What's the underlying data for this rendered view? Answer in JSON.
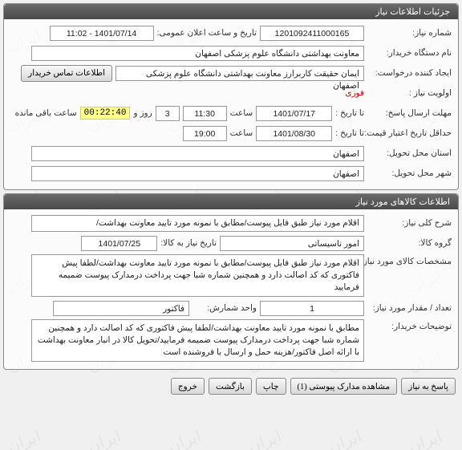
{
  "panel1": {
    "title": "جزئیات اطلاعات نیاز",
    "need_number_label": "شماره نیاز:",
    "need_number": "1201092411000165",
    "public_announce_label": "تاریخ و ساعت اعلان عمومی:",
    "public_announce": "1401/07/14 - 11:02",
    "buyer_org_label": "نام دستگاه خریدار:",
    "buyer_org": "معاونت بهداشتی دانشگاه علوم پزشکی اصفهان",
    "requester_label": "ایجاد کننده درخواست:",
    "requester": "ایمان حقیقت کاربرارز معاونت بهداشتی دانشگاه علوم پزشکی اصفهان",
    "contact_btn": "اطلاعات تماس خریدار",
    "priority_label": "اولویت نیاز :",
    "priority": "فوری",
    "deadline_reply_label": "مهلت ارسال پاسخ:",
    "to_date_label": "تا تاریخ :",
    "deadline_date": "1401/07/17",
    "time_label": "ساعت",
    "deadline_time": "11:30",
    "days_count": "3",
    "days_and": "روز و",
    "timer": "00:22:40",
    "remaining_label": "ساعت باقی مانده",
    "min_validity_label": "حداقل تاریخ اعتبار قیمت:",
    "validity_date": "1401/08/30",
    "validity_time": "19:00",
    "delivery_province_label": "استان محل تحویل:",
    "delivery_province": "اصفهان",
    "delivery_city_label": "شهر محل تحویل:",
    "delivery_city": "اصفهان"
  },
  "panel2": {
    "title": "اطلاعات کالاهای مورد نیاز",
    "need_desc_label": "شرح کلی نیاز:",
    "need_desc": "اقلام مورد نیاز طبق فایل پیوست/مطابق با نمونه مورد تایید معاونت بهداشت/",
    "goods_group_label": "گروه کالا:",
    "goods_group": "امور تاسیساتی",
    "need_by_label": "تاریخ نیاز به کالا:",
    "need_by": "1401/07/25",
    "goods_spec_label": "مشخصات کالای مورد نیاز:",
    "goods_spec": "اقلام مورد نیاز طبق فایل پیوست/مطابق با نمونه مورد تایید معاونت بهداشت/لطفا  پیش فاکتوری که کد اصالت دارد و همچنین شماره شبا جهت پرداخت درمدارک پیوست ضمیمه فرمایید",
    "qty_label": "تعداد / مقدار مورد نیاز:",
    "qty": "1",
    "unit_label": "واحد شمارش:",
    "unit": "فاکتور",
    "buyer_notes_label": "توضیحات خریدار:",
    "buyer_notes": "مطابق با نمونه مورد تایید معاونت بهداشت/لطفا  پیش فاکتوری که کد اصالت دارد و همچنین شماره شبا جهت پرداخت درمدارک پیوست ضمیمه فرمایید/تحویل کالا در انبار معاونت بهداشت با ارائه اصل فاکتور/هزینه حمل و ارسال با فروشنده است"
  },
  "buttons": {
    "reply": "پاسخ به نیاز",
    "attachments": "مشاهده مدارک پیوستی (1)",
    "print": "چاپ",
    "back": "بازگشت",
    "exit": "خروج"
  }
}
